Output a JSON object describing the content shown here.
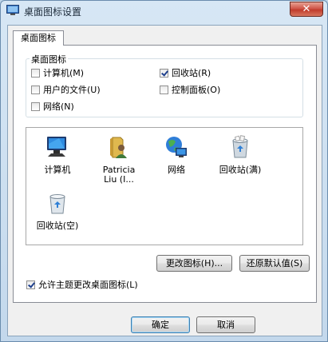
{
  "window": {
    "title": "桌面图标设置",
    "close_glyph": "✕"
  },
  "tabs": [
    {
      "label": "桌面图标"
    }
  ],
  "desktop_icons_group": {
    "legend": "桌面图标",
    "checkboxes": [
      {
        "label": "计算机(M)",
        "checked": false
      },
      {
        "label": "回收站(R)",
        "checked": true
      },
      {
        "label": "用户的文件(U)",
        "checked": false
      },
      {
        "label": "控制面板(O)",
        "checked": false
      },
      {
        "label": "网络(N)",
        "checked": false
      }
    ]
  },
  "icon_list": [
    {
      "label": "计算机",
      "sub": "",
      "icon": "computer-icon"
    },
    {
      "label": "Patricia",
      "sub": "Liu (I...",
      "icon": "user-folder-icon"
    },
    {
      "label": "网络",
      "sub": "",
      "icon": "network-icon"
    },
    {
      "label": "回收站(满)",
      "sub": "",
      "icon": "recycle-bin-full-icon"
    },
    {
      "label": "回收站(空)",
      "sub": "",
      "icon": "recycle-bin-empty-icon"
    }
  ],
  "buttons": {
    "change_icon": "更改图标(H)...",
    "restore_default": "还原默认值(S)",
    "ok": "确定",
    "cancel": "取消"
  },
  "allow_themes": {
    "label": "允许主题更改桌面图标(L)",
    "checked": true
  },
  "colors": {
    "title_bar": "#c3d8ec",
    "close_button": "#c9463a",
    "dialog_bg": "#f0f0f0"
  }
}
